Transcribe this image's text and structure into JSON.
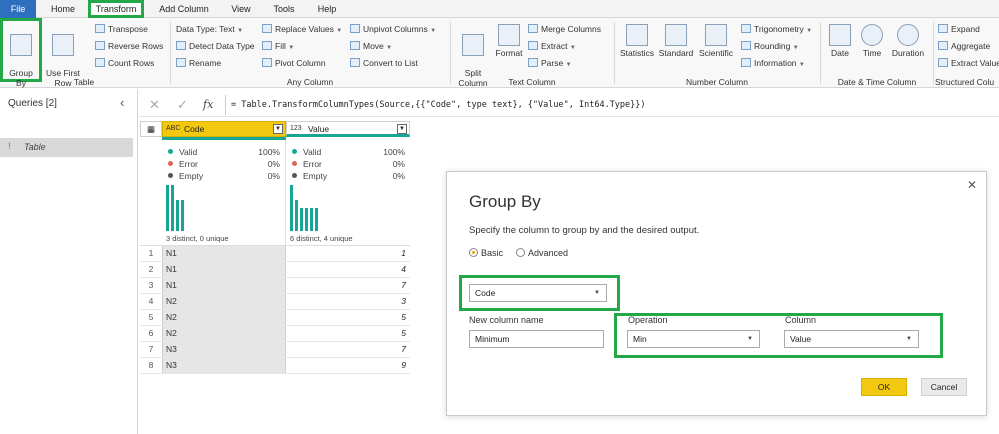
{
  "menu": {
    "file": "File",
    "home": "Home",
    "transform": "Transform",
    "add_column": "Add Column",
    "view": "View",
    "tools": "Tools",
    "help": "Help"
  },
  "ribbon": {
    "table": {
      "group_by": "Group\nBy",
      "use_first_row": "Use First Row\nas Headers",
      "transpose": "Transpose",
      "reverse_rows": "Reverse Rows",
      "count_rows": "Count Rows",
      "label": "Table"
    },
    "any_column": {
      "data_type": "Data Type: Text",
      "detect": "Detect Data Type",
      "rename": "Rename",
      "replace_values": "Replace Values",
      "fill": "Fill",
      "pivot": "Pivot Column",
      "unpivot": "Unpivot Columns",
      "move": "Move",
      "convert_list": "Convert to List",
      "label": "Any Column"
    },
    "text_column": {
      "split": "Split\nColumn",
      "format": "Format",
      "merge": "Merge Columns",
      "extract": "Extract",
      "parse": "Parse",
      "label": "Text Column"
    },
    "number_column": {
      "statistics": "Statistics",
      "standard": "Standard",
      "scientific": "Scientific",
      "trig": "Trigonometry",
      "rounding": "Rounding",
      "information": "Information",
      "label": "Number Column"
    },
    "datetime": {
      "date": "Date",
      "time": "Time",
      "duration": "Duration",
      "label": "Date & Time Column"
    },
    "structured": {
      "expand": "Expand",
      "aggregate": "Aggregate",
      "extract_values": "Extract Values",
      "label": "Structured Colu"
    }
  },
  "queries": {
    "title": "Queries [2]",
    "item": "Table"
  },
  "formula": "= Table.TransformColumnTypes(Source,{{\"Code\", type text}, {\"Value\", Int64.Type}})",
  "grid": {
    "col1": {
      "type": "ABC",
      "name": "Code",
      "valid": "Valid",
      "valid_pct": "100%",
      "error": "Error",
      "error_pct": "0%",
      "empty": "Empty",
      "empty_pct": "0%",
      "distinct": "3 distinct, 0 unique"
    },
    "col2": {
      "type": "123",
      "name": "Value",
      "valid": "Valid",
      "valid_pct": "100%",
      "error": "Error",
      "error_pct": "0%",
      "empty": "Empty",
      "empty_pct": "0%",
      "distinct": "6 distinct, 4 unique"
    },
    "rows": [
      {
        "n": "1",
        "code": "N1",
        "value": "1"
      },
      {
        "n": "2",
        "code": "N1",
        "value": "4"
      },
      {
        "n": "3",
        "code": "N1",
        "value": "7"
      },
      {
        "n": "4",
        "code": "N2",
        "value": "3"
      },
      {
        "n": "5",
        "code": "N2",
        "value": "5"
      },
      {
        "n": "6",
        "code": "N2",
        "value": "5"
      },
      {
        "n": "7",
        "code": "N3",
        "value": "7"
      },
      {
        "n": "8",
        "code": "N3",
        "value": "9"
      }
    ]
  },
  "dialog": {
    "title": "Group By",
    "subtitle": "Specify the column to group by and the desired output.",
    "basic": "Basic",
    "advanced": "Advanced",
    "group_column": "Code",
    "new_col_label": "New column name",
    "new_col_value": "Minimum",
    "operation_label": "Operation",
    "operation_value": "Min",
    "column_label": "Column",
    "column_value": "Value",
    "ok": "OK",
    "cancel": "Cancel"
  },
  "colors": {
    "accent_green": "#22a846",
    "teal": "#17a596",
    "ok_yellow": "#f2c811",
    "file_blue": "#2f6fbf"
  }
}
